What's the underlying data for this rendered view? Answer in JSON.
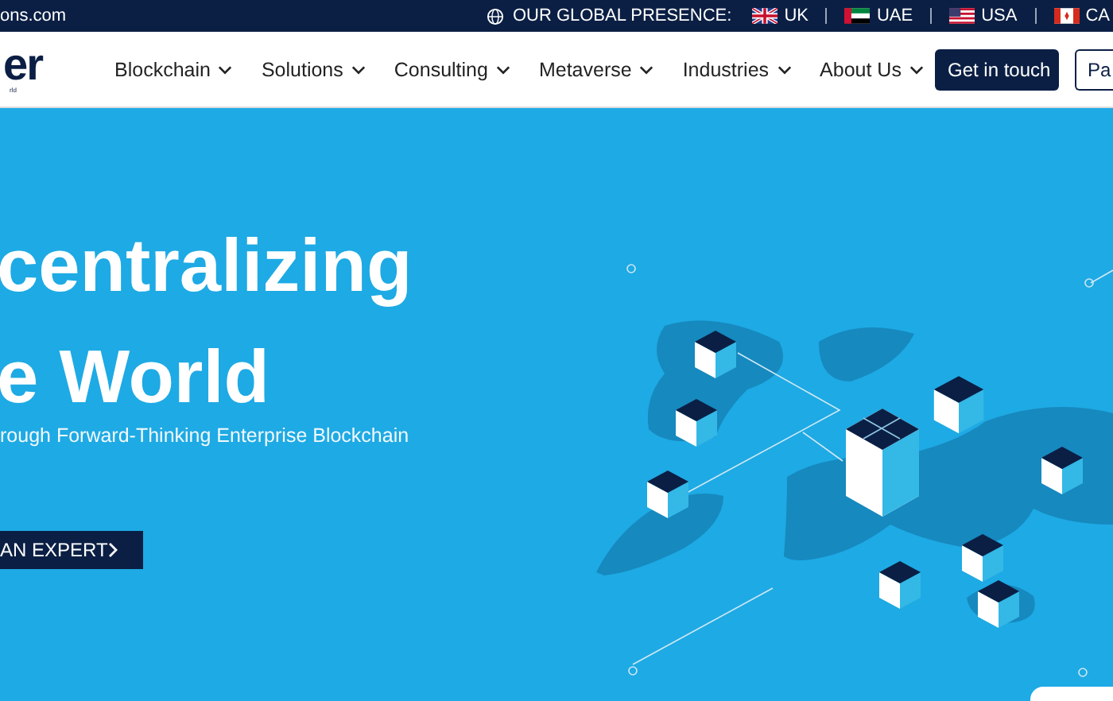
{
  "top_bar": {
    "email": "ons.com",
    "presence_label": "OUR GLOBAL PRESENCE:",
    "regions": [
      {
        "label": "UK",
        "kind": "uk"
      },
      {
        "label": "UAE",
        "kind": "uae"
      },
      {
        "label": "USA",
        "kind": "usa"
      },
      {
        "label": "CA",
        "kind": "ca"
      }
    ]
  },
  "header": {
    "logo": "er",
    "logo_tagline": "rld",
    "nav": [
      {
        "label": "Blockchain"
      },
      {
        "label": "Solutions"
      },
      {
        "label": "Consulting"
      },
      {
        "label": "Metaverse"
      },
      {
        "label": "Industries"
      },
      {
        "label": "About Us"
      }
    ],
    "cta": "Get in touch",
    "secondary": "Pa"
  },
  "hero": {
    "title_lines": [
      "centralizing",
      "e World"
    ],
    "subtitle": "rough Forward-Thinking Enterprise Blockchain",
    "button": "AN EXPERT"
  }
}
